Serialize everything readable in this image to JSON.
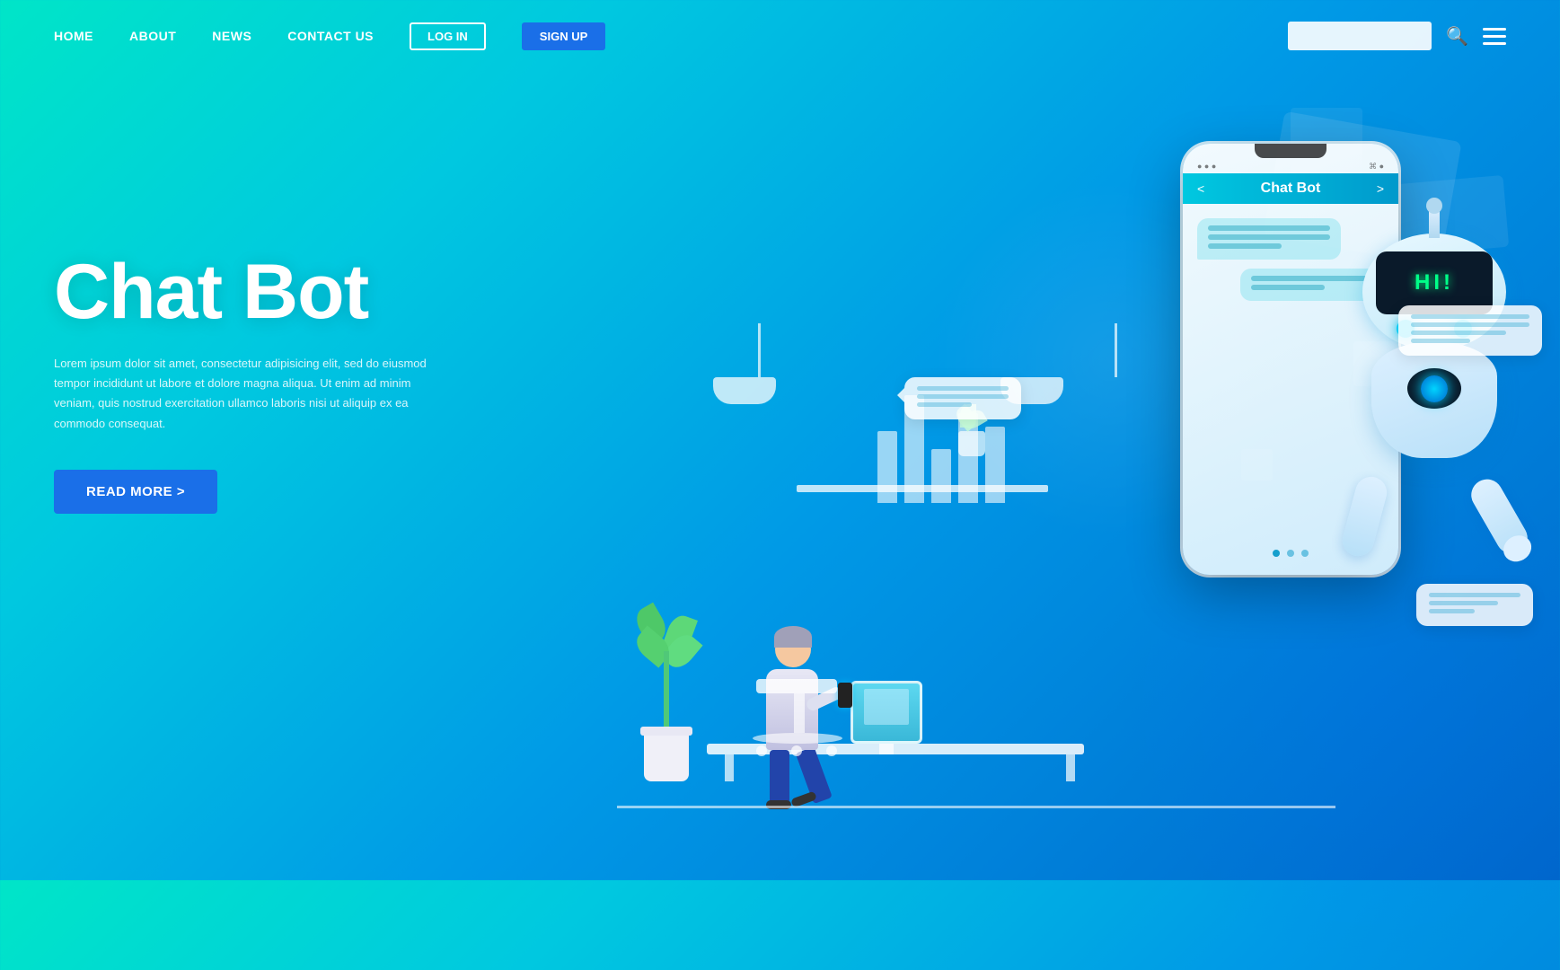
{
  "nav": {
    "links": [
      {
        "label": "HOME",
        "key": "home"
      },
      {
        "label": "ABOUT",
        "key": "about"
      },
      {
        "label": "NEWS",
        "key": "news"
      },
      {
        "label": "CONTACT US",
        "key": "contact"
      }
    ],
    "login_label": "LOG IN",
    "signup_label": "SIGN UP",
    "search_placeholder": ""
  },
  "hero": {
    "title": "Chat Bot",
    "description": "Lorem ipsum dolor sit amet, consectetur adipisicing elit, sed do eiusmod tempor incididunt ut labore et dolore magna aliqua. Ut enim ad minim veniam, quis nostrud exercitation ullamco laboris nisi ut aliquip ex ea commodo consequat.",
    "cta_label": "READ MORE  >"
  },
  "phone": {
    "title": "Chat Bot",
    "status_dots": "● ● ●",
    "wifi_icon": "wifi"
  },
  "robot": {
    "hi_text": "HI!",
    "visor_color": "#0a1a2a",
    "eye_color": "#00d4ff"
  },
  "chat_bubbles": {
    "left_lines": [
      "long",
      "long",
      "short"
    ],
    "right1_lines": [
      "long",
      "long",
      "medium",
      "short"
    ],
    "right2_lines": [
      "long",
      "medium",
      "short"
    ]
  },
  "colors": {
    "bg_start": "#00e5c8",
    "bg_end": "#0066cc",
    "signup_bg": "#1a6fe8",
    "cta_bg": "#1a6fe8",
    "robot_hi": "#00ff88"
  }
}
